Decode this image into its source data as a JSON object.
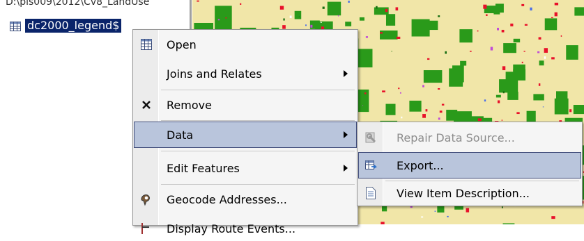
{
  "toc": {
    "path": "D:\\pls009\\2012\\Cv8_LandUse",
    "layer_name": "dc2000_legend$"
  },
  "context_menu": {
    "items": [
      {
        "label": "Open",
        "icon": "table-icon",
        "submenu": false
      },
      {
        "label": "Joins and Relates",
        "icon": "",
        "submenu": true
      },
      {
        "label": "Remove",
        "icon": "close-icon",
        "submenu": false
      },
      {
        "label": "Data",
        "icon": "",
        "submenu": true,
        "highlighted": true
      },
      {
        "label": "Edit Features",
        "icon": "",
        "submenu": true
      },
      {
        "label": "Geocode Addresses...",
        "icon": "geocode-icon",
        "submenu": false
      },
      {
        "label": "Display Route Events...",
        "icon": "route-events-icon",
        "submenu": false
      }
    ]
  },
  "data_submenu": {
    "items": [
      {
        "label": "Repair Data Source...",
        "icon": "repair-data-source-icon",
        "disabled": true
      },
      {
        "label": "Export...",
        "icon": "export-table-icon",
        "highlighted": true
      },
      {
        "label": "View Item Description...",
        "icon": "document-icon",
        "disabled": false
      }
    ]
  },
  "colors": {
    "highlight": "#b9c5dc",
    "selection": "#0a246a",
    "map_forest": "#2a9a1a",
    "map_urban": "#e8112a",
    "map_agri": "#f1e6a8"
  }
}
